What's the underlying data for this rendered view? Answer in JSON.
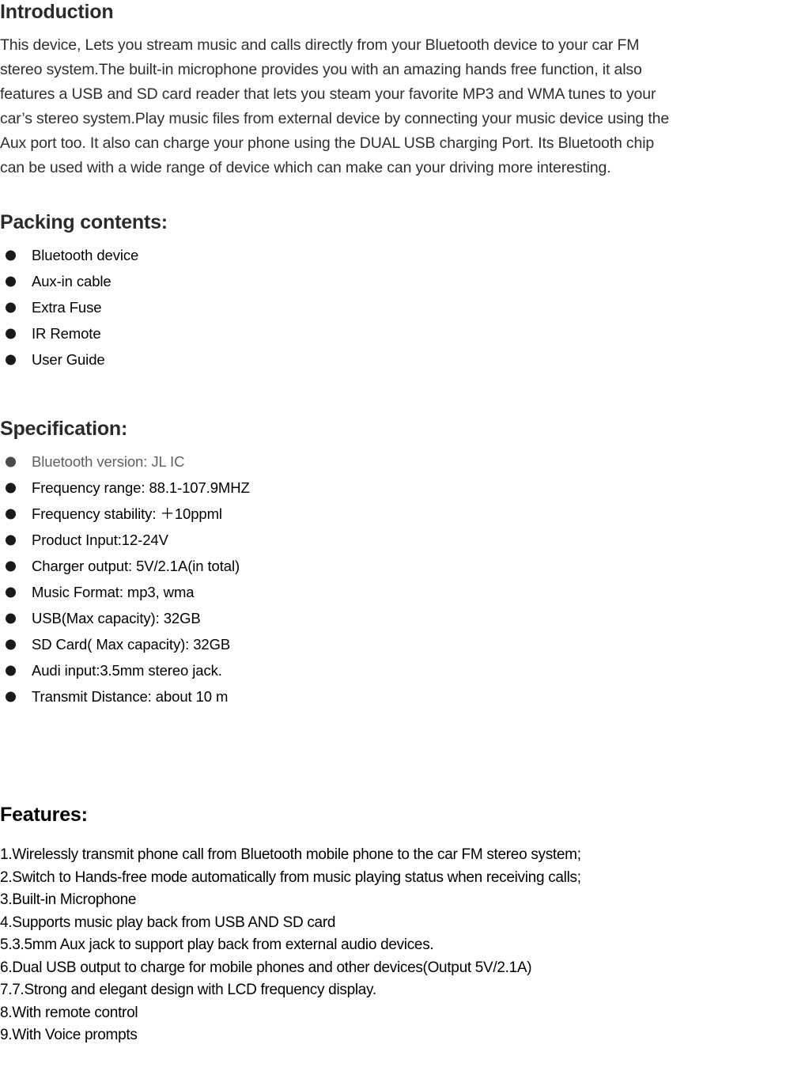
{
  "document": {
    "sections": [
      {
        "id": "introduction",
        "heading": "Introduction",
        "paragraph_lines": [
          "This device, Lets you stream music and calls directly from your Bluetooth device to your car FM",
          "stereo system.The built-in microphone provides you with an amazing hands free function, it also",
          "features a USB and SD card reader that lets you steam your favorite MP3 and WMA tunes to your",
          "car’s stereo system.Play music files from external device by connecting your music device using the",
          "Aux port too. It also can charge your phone using the DUAL USB charging Port. Its Bluetooth chip",
          "can be used with a wide range of device which can make can your driving more interesting."
        ]
      },
      {
        "id": "packing-contents",
        "heading": "Packing contents:",
        "items": [
          "Bluetooth device",
          "Aux-in cable",
          "Extra Fuse",
          "IR Remote",
          "User Guide"
        ]
      },
      {
        "id": "specification",
        "heading": "Specification:",
        "items": [
          "Bluetooth version: JL IC",
          "Frequency range: 88.1-107.9MHZ",
          "Frequency stability:  ＋10ppml",
          "Product Input:12-24V",
          "Charger output: 5V/2.1A(in total)",
          "Music Format: mp3, wma",
          "USB(Max capacity): 32GB",
          "SD Card( Max capacity): 32GB",
          "Audi input:3.5mm stereo jack.",
          "Transmit Distance: about 10 m"
        ]
      },
      {
        "id": "features",
        "heading": "Features:",
        "items": [
          "1.Wirelessly transmit phone call from Bluetooth mobile phone to the car FM stereo system;",
          "2.Switch to Hands-free mode automatically from music playing status when receiving calls;",
          "3.Built-in Microphone",
          "4.Supports music play back from USB AND SD card",
          "5.3.5mm Aux jack to support play back from external audio devices.",
          "6.Dual USB output to charge for mobile phones and other devices(Output 5V/2.1A)",
          "7.7.Strong and elegant design with LCD frequency display.",
          "8.With remote control",
          "9.With Voice prompts"
        ]
      }
    ]
  },
  "colors": {
    "heading": "#2b2b2b",
    "body_text": "#2f2f2f",
    "list_text": "#000000",
    "muted_text": "#606060",
    "background": "#ffffff"
  }
}
